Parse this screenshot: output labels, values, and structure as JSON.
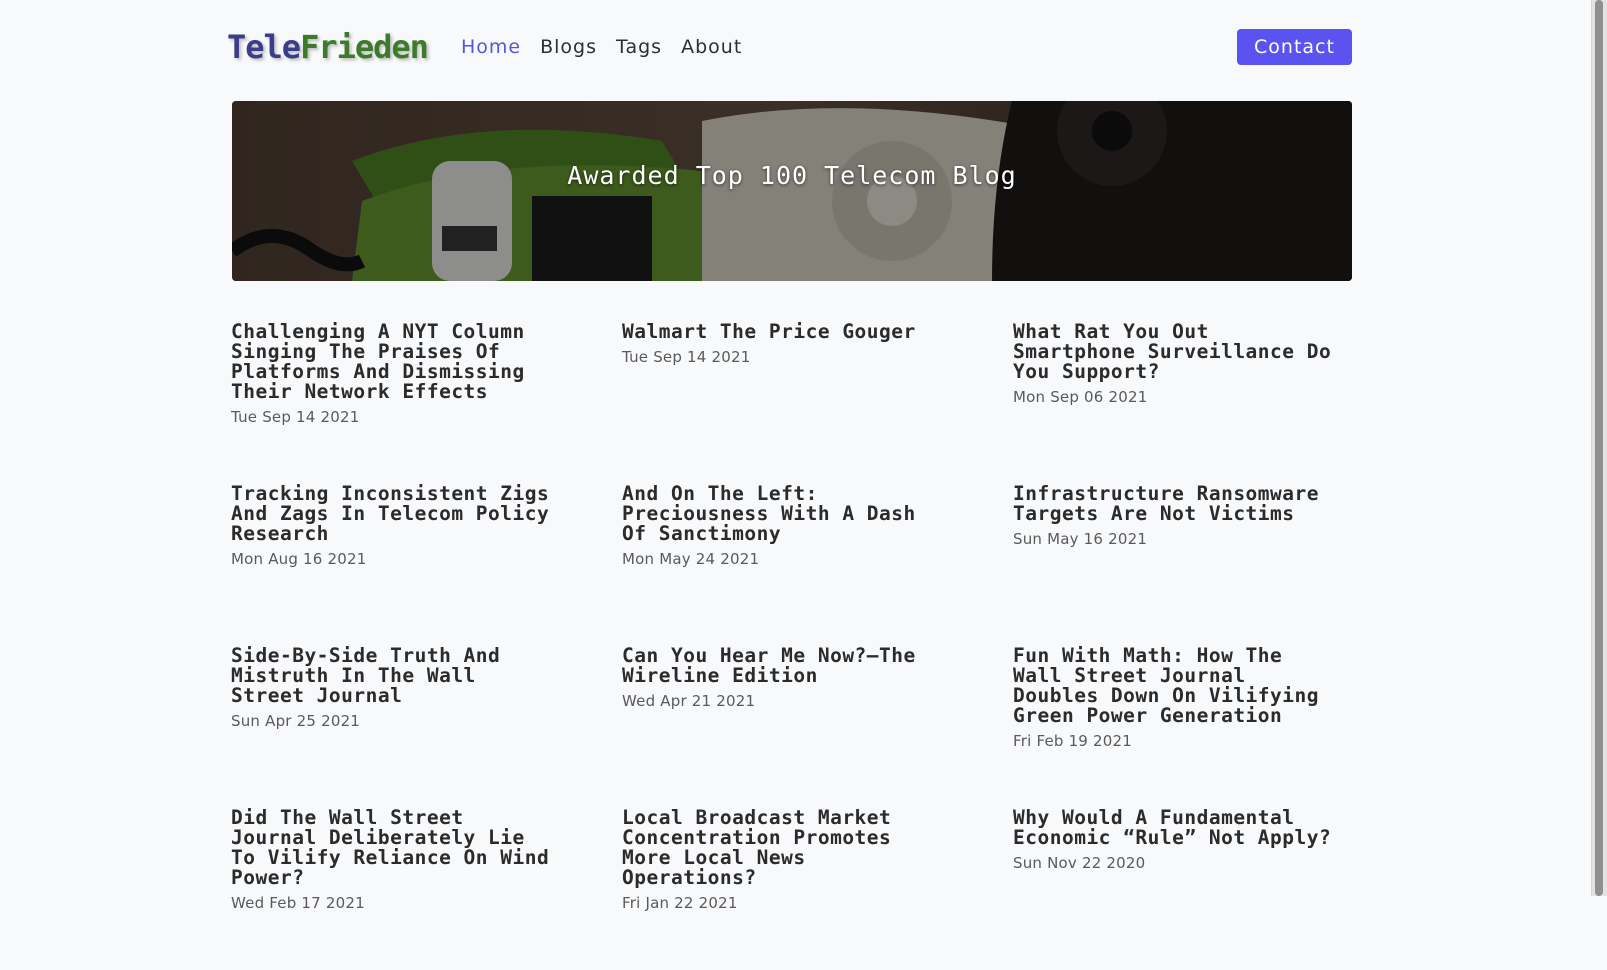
{
  "header": {
    "logo_part1": "Tele",
    "logo_part2": "Frieden",
    "nav": [
      "Home",
      "Blogs",
      "Tags",
      "About"
    ],
    "contact_label": "Contact"
  },
  "hero": {
    "title": "Awarded Top 100 Telecom Blog"
  },
  "posts": [
    {
      "title": "Challenging A NYT Column Singing The Praises Of Platforms And Dismissing Their Network Effects",
      "date": "Tue Sep 14 2021"
    },
    {
      "title": "Walmart The Price Gouger",
      "date": "Tue Sep 14 2021"
    },
    {
      "title": "What Rat You Out Smartphone Surveillance Do You Support?",
      "date": "Mon Sep 06 2021"
    },
    {
      "title": "Tracking Inconsistent Zigs And Zags In Telecom Policy Research",
      "date": "Mon Aug 16 2021"
    },
    {
      "title": "And On The Left: Preciousness With A Dash Of Sanctimony",
      "date": "Mon May 24 2021"
    },
    {
      "title": "Infrastructure Ransomware Targets Are Not Victims",
      "date": "Sun May 16 2021"
    },
    {
      "title": "Side-By-Side Truth And Mistruth In The Wall Street Journal",
      "date": "Sun Apr 25 2021"
    },
    {
      "title": "Can You Hear Me Now?—The Wireline Edition",
      "date": "Wed Apr 21 2021"
    },
    {
      "title": "Fun With Math: How The Wall Street Journal Doubles Down On Vilifying Green Power Generation",
      "date": "Fri Feb 19 2021"
    },
    {
      "title": "Did The Wall Street Journal Deliberately Lie To Vilify Reliance On Wind Power?",
      "date": "Wed Feb 17 2021"
    },
    {
      "title": "Local Broadcast Market Concentration Promotes More Local News Operations?",
      "date": "Fri Jan 22 2021"
    },
    {
      "title": "Why Would A Fundamental Economic “Rule” Not Apply?",
      "date": "Sun Nov 22 2020"
    }
  ],
  "colors": {
    "accent": "#5b53f0",
    "active_link": "#5856d6",
    "logo_primary": "#3c3d8a",
    "logo_secondary": "#3d7a2a"
  }
}
